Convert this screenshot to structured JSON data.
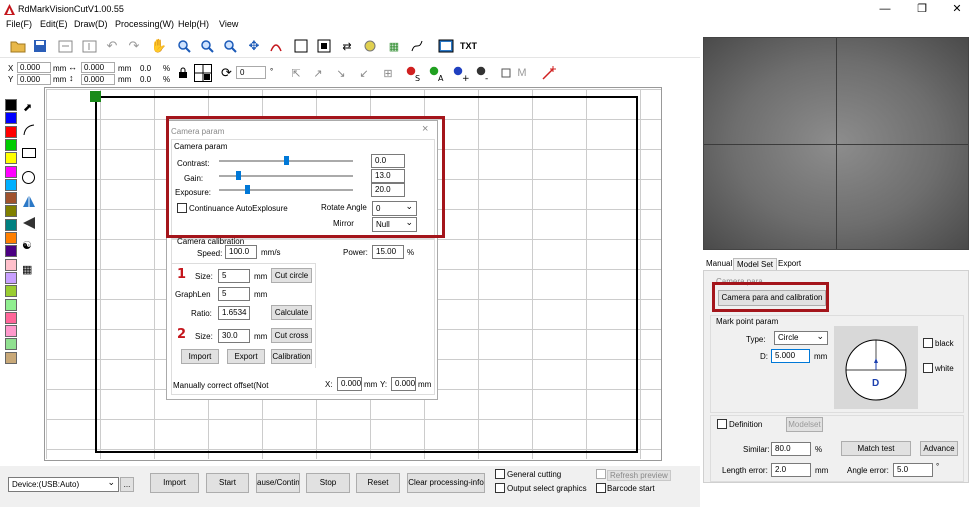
{
  "app": {
    "title": "RdMarkVisionCutV1.00.55"
  },
  "menu": {
    "file": "File(F)",
    "edit": "Edit(E)",
    "draw": "Draw(D)",
    "processing": "Processing(W)",
    "help": "Help(H)",
    "view": "View"
  },
  "toolbar": {
    "txt_label": "TXT"
  },
  "coords": {
    "x_label": "X",
    "y_label": "Y",
    "x_value": "0.000",
    "y_value": "0.000",
    "w_value": "0.000",
    "h_value": "0.000",
    "unit": "mm",
    "x_pct": "0.0",
    "y_pct": "0.0",
    "pct_sign": "%",
    "rotation_value": "0",
    "deg_sign": "°"
  },
  "camera_param": {
    "dialog_title": "Camera param",
    "group_title": "Camera param",
    "contrast_label": "Contrast:",
    "contrast_value": "0.0",
    "gain_label": "Gain:",
    "gain_value": "13.0",
    "exposure_label": "Exposure:",
    "exposure_value": "20.0",
    "auto_exposure_label": "Continuance AutoExplosure",
    "rotate_label": "Rotate Angle",
    "rotate_value": "0",
    "mirror_label": "Mirror",
    "mirror_value": "Null"
  },
  "calibration": {
    "group_title": "Camera calibration",
    "speed_label": "Speed:",
    "speed_value": "100.0",
    "speed_unit": "mm/s",
    "power_label": "Power:",
    "power_value": "15.00",
    "power_unit": "%",
    "step1_marker": "1",
    "size_label": "Size:",
    "size1_value": "5",
    "mm": "mm",
    "cut_circle_button": "Cut circle",
    "graphlen_label": "GraphLen",
    "graphlen_value": "5",
    "ratio_label": "Ratio:",
    "ratio_value": "1.6534",
    "calculate_button": "Calculate",
    "step2_marker": "2",
    "size2_value": "30.0",
    "cut_cross_button": "Cut cross",
    "import_button": "Import",
    "export_button": "Export",
    "calibration_button": "Calibration",
    "offset_label": "Manually correct offset(Not",
    "offset_x_label": "X:",
    "offset_x_value": "0.000",
    "offset_x_unit": "mm",
    "offset_y_label": "Y:",
    "offset_y_value": "0.000",
    "offset_y_unit": "mm"
  },
  "right_panel": {
    "tabs": [
      "Manual",
      "Model Set",
      "Export"
    ],
    "camera_group_title": "Camera para",
    "camera_para_button": "Camera para and calibration",
    "mark_group_title": "Mark point param",
    "type_label": "Type:",
    "type_value": "Circle",
    "d_label": "D:",
    "d_value": "5.000",
    "d_unit": "mm",
    "black_label": "black",
    "white_label": "white",
    "marker_letter": "D",
    "definition_label": "Definition",
    "modelset_button": "Modelset",
    "similar_label": "Similar:",
    "similar_value": "80.0",
    "similar_unit": "%",
    "match_test_button": "Match test",
    "advance_button": "Advance",
    "length_error_label": "Length error:",
    "length_error_value": "2.0",
    "length_error_unit": "mm",
    "angle_error_label": "Angle error:",
    "angle_error_value": "5.0",
    "angle_unit": "°"
  },
  "bottom": {
    "device_value": "Device:(USB:Auto)",
    "device_more": "...",
    "import_button": "Import",
    "start_button": "Start",
    "pause_button": "ause/Continu",
    "stop_button": "Stop",
    "reset_button": "Reset",
    "clear_button": "Clear processing-info",
    "general_cutting_label": "General cutting",
    "refresh_preview_label": "Refresh preview",
    "output_select_label": "Output select graphics",
    "barcode_start_label": "Barcode start"
  },
  "colors": {
    "highlight": "#a4151b",
    "origin": "#1a8a1a",
    "accent": "#0078d7"
  },
  "palette": [
    "#000000",
    "#0000ff",
    "#ff0000",
    "#00cc00",
    "#ffff00",
    "#ff00ff",
    "#00b0ff",
    "#a0522d",
    "#808000",
    "#008080",
    "#ff7f00",
    "#4b0082",
    "#ffc0cb",
    "#c8a0ff",
    "#9acd32",
    "#90ee90",
    "#ff6699",
    "#ff99cc",
    "#90e090",
    "#c8a878"
  ]
}
